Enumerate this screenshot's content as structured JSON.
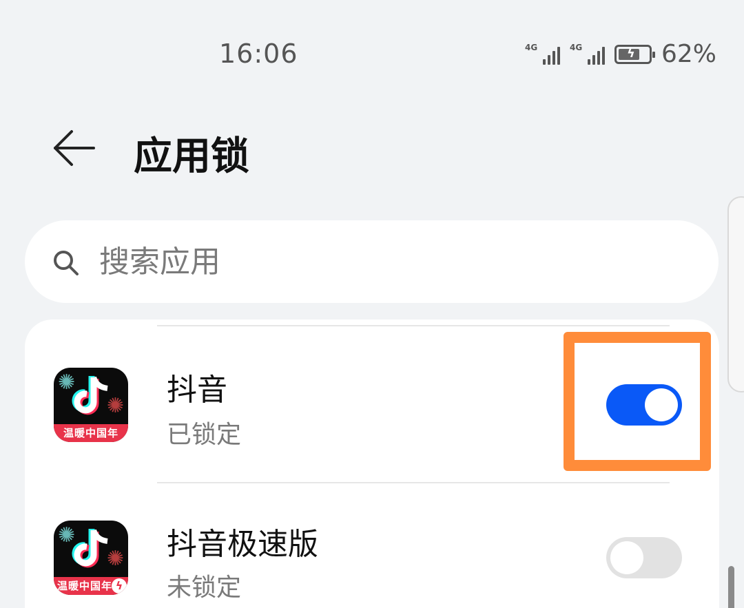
{
  "status_bar": {
    "time": "16:06",
    "network_1": "4G",
    "network_2": "4G",
    "battery_percent": "62%"
  },
  "header": {
    "title": "应用锁",
    "back_icon": "arrow-left-icon"
  },
  "search": {
    "placeholder": "搜索应用",
    "icon": "search-icon"
  },
  "apps": [
    {
      "name": "抖音",
      "status": "已锁定",
      "icon_banner": "温暖中国年",
      "locked": true
    },
    {
      "name": "抖音极速版",
      "status": "未锁定",
      "icon_banner": "温暖中国年",
      "locked": false
    }
  ],
  "colors": {
    "accent": "#0a59f7",
    "highlight": "#ff8c3a",
    "background": "#f1f3f5"
  }
}
